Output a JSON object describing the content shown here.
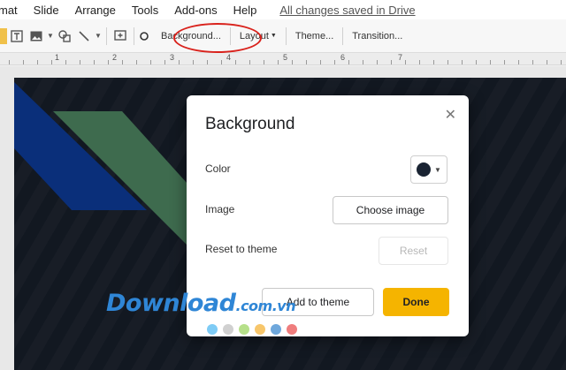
{
  "menu": {
    "items": [
      "mat",
      "Slide",
      "Arrange",
      "Tools",
      "Add-ons",
      "Help"
    ],
    "saved_status": "All changes saved in Drive"
  },
  "toolbar": {
    "background_label": "Background...",
    "layout_label": "Layout",
    "theme_label": "Theme...",
    "transition_label": "Transition...",
    "highlight_color": "#d9221c"
  },
  "ruler": {
    "marks": [
      "1",
      "2",
      "3",
      "4",
      "5",
      "6",
      "7"
    ]
  },
  "dialog": {
    "title": "Background",
    "color_label": "Color",
    "color_value": "#1a2433",
    "image_label": "Image",
    "choose_image_label": "Choose image",
    "reset_label": "Reset to theme",
    "reset_button_label": "Reset",
    "add_to_theme_label": "Add to theme",
    "done_label": "Done",
    "close_icon": "close-icon"
  },
  "watermark": {
    "text": "Download",
    "domain": ".com.vn",
    "dot_colors": [
      "#7ecbf5",
      "#d0d0d0",
      "#b6e08a",
      "#f7c66b",
      "#6fa8dc",
      "#ef7d7d"
    ]
  },
  "colors": {
    "accent": "#f5b400",
    "slide_bg": "#121821",
    "shape_blue": "#0a2f7a",
    "shape_green": "#3e6b4e"
  }
}
